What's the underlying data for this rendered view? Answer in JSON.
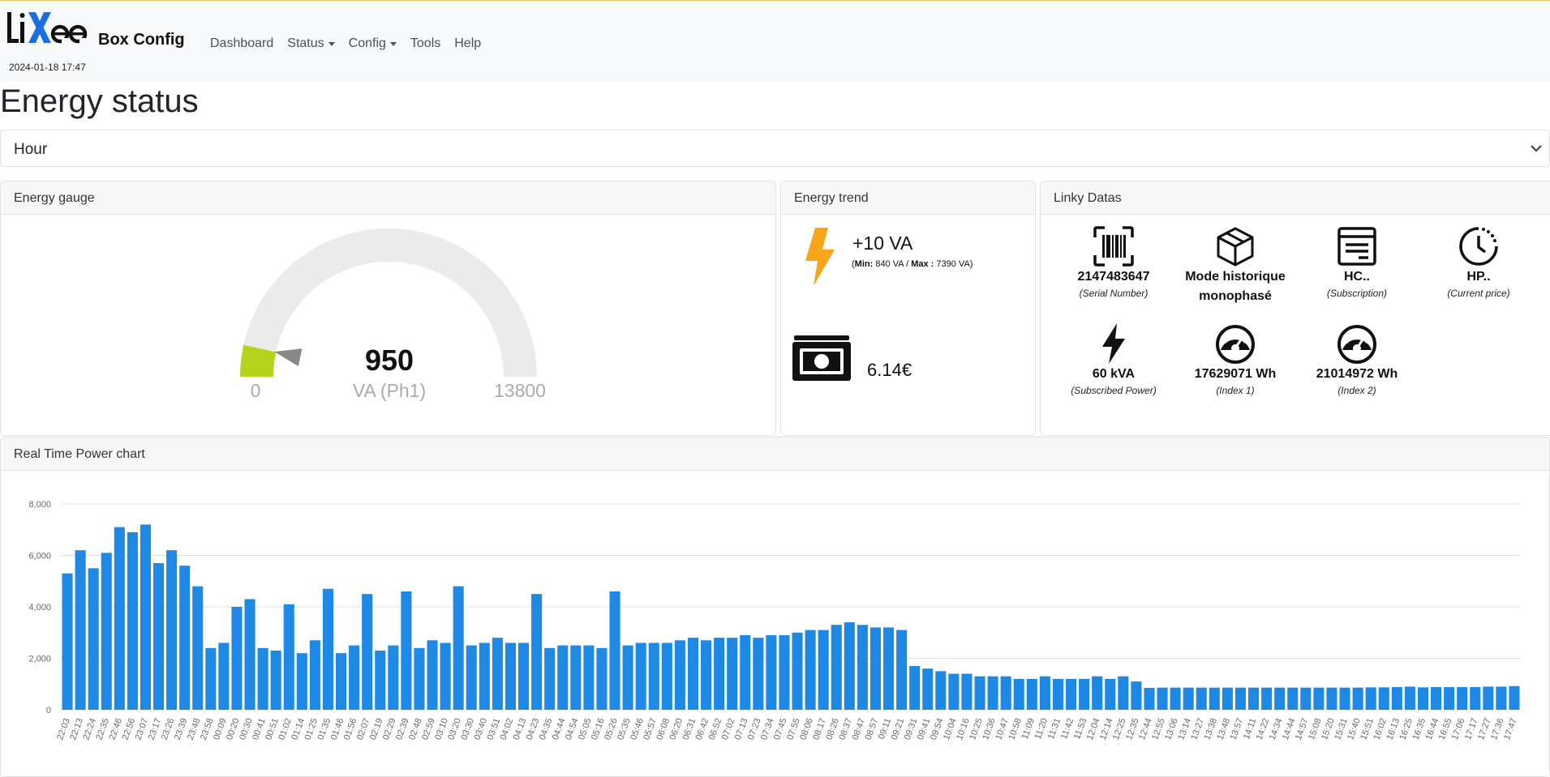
{
  "header": {
    "logo_text": "liXee",
    "brand": "Box Config",
    "datetime": "2024-01-18 17:47",
    "nav": [
      {
        "label": "Dashboard",
        "dropdown": false
      },
      {
        "label": "Status",
        "dropdown": true
      },
      {
        "label": "Config",
        "dropdown": true
      },
      {
        "label": "Tools",
        "dropdown": false
      },
      {
        "label": "Help",
        "dropdown": false
      }
    ]
  },
  "page": {
    "title": "Energy status",
    "period_select": {
      "value": "Hour",
      "icon": "chevron-down-icon"
    }
  },
  "gauge": {
    "header": "Energy gauge",
    "value": 950,
    "unit": "VA (Ph1)",
    "min": 0,
    "max": 13800,
    "fill_color": "#b5d31b",
    "track_color": "#ebebeb",
    "needle_color": "#888888"
  },
  "trend": {
    "header": "Energy trend",
    "icon": "lightning-icon",
    "icon_color": "#f7a51b",
    "main": "+10 VA",
    "min_label": "Min:",
    "min_value": "840 VA",
    "separator": "/",
    "max_label": "Max :",
    "max_value": "7390 VA",
    "cost_icon": "banknote-icon",
    "cost": "6.14€"
  },
  "linky": {
    "header": "Linky Datas",
    "items": [
      {
        "icon": "barcode-icon",
        "value": "2147483647",
        "label": "(Serial Number)"
      },
      {
        "icon": "box-icon",
        "value": "Mode historique monophasé",
        "label": ""
      },
      {
        "icon": "document-icon",
        "value": "HC..",
        "label": "(Subscription)"
      },
      {
        "icon": "clock-icon",
        "value": "HP..",
        "label": "(Current price)"
      },
      {
        "icon": "lightning-icon",
        "value": "60 kVA",
        "label": "(Subscribed Power)"
      },
      {
        "icon": "speedometer-icon",
        "value": "17629071 Wh",
        "label": "(Index 1)"
      },
      {
        "icon": "speedometer-icon",
        "value": "21014972 Wh",
        "label": "(Index 2)"
      }
    ]
  },
  "chart": {
    "header": "Real Time Power chart"
  },
  "chart_data": {
    "type": "bar",
    "title": "Real Time Power chart",
    "xlabel": "",
    "ylabel": "",
    "ylim": [
      0,
      8000
    ],
    "yticks": [
      "0",
      "2,000",
      "4,000",
      "6,000",
      "8,000"
    ],
    "grid": true,
    "bar_color": "#1e88e5",
    "x": [
      "22:03",
      "22:13",
      "22:24",
      "22:35",
      "22:46",
      "22:56",
      "23:07",
      "23:17",
      "23:26",
      "23:39",
      "23:48",
      "23:58",
      "00:09",
      "00:20",
      "00:30",
      "00:41",
      "00:51",
      "01:02",
      "01:14",
      "01:25",
      "01:35",
      "01:46",
      "01:56",
      "02:07",
      "02:19",
      "02:29",
      "02:39",
      "02:48",
      "02:59",
      "03:10",
      "03:20",
      "03:30",
      "03:40",
      "03:51",
      "04:02",
      "04:13",
      "04:23",
      "04:35",
      "04:44",
      "04:54",
      "05:05",
      "05:16",
      "05:26",
      "05:35",
      "05:46",
      "05:57",
      "06:08",
      "06:20",
      "06:31",
      "06:42",
      "06:52",
      "07:02",
      "07:13",
      "07:23",
      "07:34",
      "07:45",
      "07:55",
      "08:06",
      "08:17",
      "08:26",
      "08:37",
      "08:47",
      "08:57",
      "09:11",
      "09:21",
      "09:31",
      "09:41",
      "09:54",
      "10:04",
      "10:16",
      "10:25",
      "10:36",
      "10:47",
      "10:58",
      "11:09",
      "11:20",
      "11:31",
      "11:42",
      "11:53",
      "12:04",
      "12:14",
      "12:25",
      "12:35",
      "12:44",
      "12:55",
      "13:06",
      "13:14",
      "13:27",
      "13:38",
      "13:48",
      "13:57",
      "14:11",
      "14:22",
      "14:34",
      "14:44",
      "14:57",
      "15:08",
      "15:20",
      "15:31",
      "15:40",
      "15:51",
      "16:02",
      "16:13",
      "16:25",
      "16:35",
      "16:44",
      "16:55",
      "17:06",
      "17:17",
      "17:27",
      "17:36",
      "17:47"
    ],
    "values": [
      5300,
      6200,
      5500,
      6100,
      7100,
      6900,
      7200,
      5700,
      6200,
      5600,
      4800,
      2400,
      2600,
      4000,
      4300,
      2400,
      2300,
      4100,
      2200,
      2700,
      4700,
      2200,
      2500,
      4500,
      2300,
      2500,
      4600,
      2400,
      2700,
      2600,
      4800,
      2500,
      2600,
      2800,
      2600,
      2600,
      4500,
      2400,
      2500,
      2500,
      2500,
      2400,
      4600,
      2500,
      2600,
      2600,
      2600,
      2700,
      2800,
      2700,
      2800,
      2800,
      2900,
      2800,
      2900,
      2900,
      3000,
      3100,
      3100,
      3300,
      3400,
      3300,
      3200,
      3200,
      3100,
      1700,
      1600,
      1500,
      1400,
      1400,
      1300,
      1300,
      1300,
      1200,
      1200,
      1300,
      1200,
      1200,
      1200,
      1300,
      1200,
      1300,
      1100,
      850,
      860,
      860,
      860,
      860,
      860,
      860,
      860,
      860,
      860,
      860,
      860,
      860,
      860,
      860,
      860,
      860,
      870,
      870,
      880,
      900,
      870,
      880,
      880,
      880,
      880,
      900,
      900,
      920
    ]
  }
}
